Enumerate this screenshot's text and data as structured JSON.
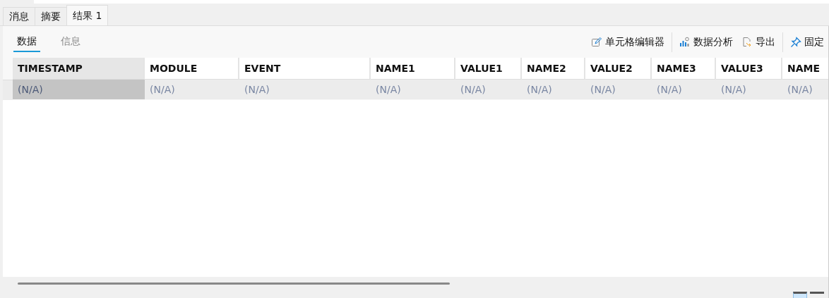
{
  "tabs": [
    {
      "label": "消息",
      "selected": false
    },
    {
      "label": "摘要",
      "selected": false
    },
    {
      "label": "结果 1",
      "selected": true
    }
  ],
  "subtabs": [
    {
      "label": "数据",
      "selected": true
    },
    {
      "label": "信息",
      "selected": false
    }
  ],
  "toolbar": [
    {
      "kind": "edit",
      "label": "单元格编辑器"
    },
    {
      "kind": "chart",
      "label": "数据分析"
    },
    {
      "kind": "export",
      "label": "导出"
    },
    {
      "kind": "pin",
      "label": "固定"
    }
  ],
  "table": {
    "columns": [
      {
        "label": "TIMESTAMP",
        "selected": true
      },
      {
        "label": "MODULE",
        "selected": false
      },
      {
        "label": "EVENT",
        "selected": false
      },
      {
        "label": "NAME1",
        "selected": false
      },
      {
        "label": "VALUE1",
        "selected": false
      },
      {
        "label": "NAME2",
        "selected": false
      },
      {
        "label": "VALUE2",
        "selected": false
      },
      {
        "label": "NAME3",
        "selected": false
      },
      {
        "label": "VALUE3",
        "selected": false
      },
      {
        "label": "NAME",
        "selected": false
      }
    ],
    "rows": [
      [
        "(N/A)",
        "(N/A)",
        "(N/A)",
        "(N/A)",
        "(N/A)",
        "(N/A)",
        "(N/A)",
        "(N/A)",
        "(N/A)",
        "(N/A)"
      ]
    ]
  }
}
